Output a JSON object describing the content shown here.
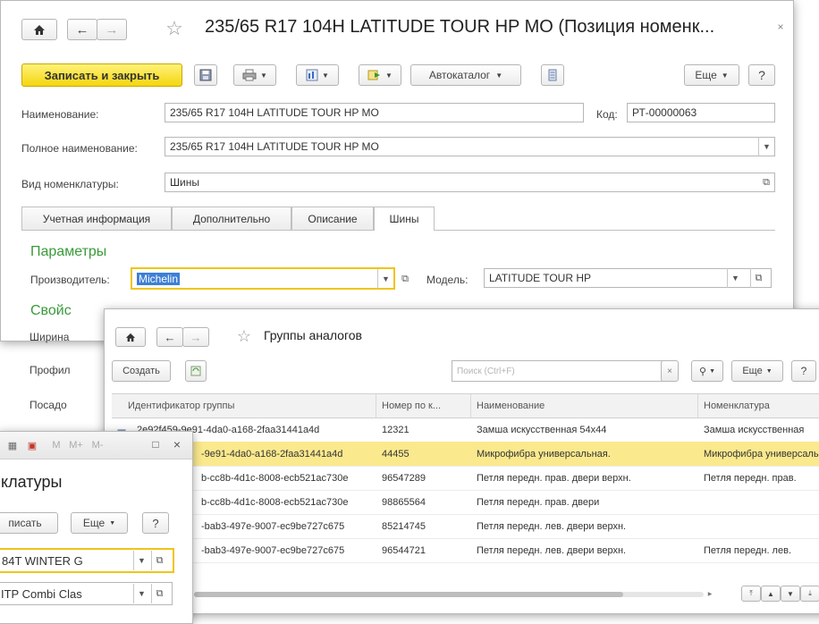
{
  "main": {
    "title": "235/65 R17 104H  LATITUDE TOUR HP MO (Позиция номенк...",
    "toolbar": {
      "save_close": "Записать и закрыть",
      "autocatalog": "Автокаталог",
      "more": "Еще",
      "help": "?"
    },
    "fields": {
      "name_label": "Наименование:",
      "name_value": "235/65 R17 104H  LATITUDE TOUR HP MO",
      "code_label": "Код:",
      "code_value": "РТ-00000063",
      "full_name_label": "Полное наименование:",
      "full_name_value": "235/65 R17 104H  LATITUDE TOUR HP MO",
      "kind_label": "Вид номенклатуры:",
      "kind_value": "Шины"
    },
    "tabs": [
      "Учетная информация",
      "Дополнительно",
      "Описание",
      "Шины"
    ],
    "params_title": "Параметры",
    "producer_label": "Производитель:",
    "producer_value": "Michelin",
    "model_label": "Модель:",
    "model_value": "LATITUDE TOUR HP",
    "props_title": "Свойс",
    "side_labels": [
      "Ширина",
      "Профил",
      "Посадо"
    ]
  },
  "analogs": {
    "title": "Группы аналогов",
    "create": "Создать",
    "search_placeholder": "Поиск (Ctrl+F)",
    "more": "Еще",
    "help": "?",
    "columns": [
      "Идентификатор группы",
      "Номер по к...",
      "Наименование",
      "Номенклатура"
    ],
    "rows": [
      {
        "id": "2e92f459-9e91-4da0-a168-2faa31441a4d",
        "num": "12321",
        "name": "Замша искусственная 54x44",
        "nom": "Замша искусственная"
      },
      {
        "id": "-9e91-4da0-a168-2faa31441a4d",
        "num": "44455",
        "name": "Микрофибра универсальная.",
        "nom": "Микрофибра универсальная"
      },
      {
        "id": "b-cc8b-4d1c-8008-ecb521ac730e",
        "num": "96547289",
        "name": "Петля передн. прав. двери верхн.",
        "nom": "Петля передн. прав."
      },
      {
        "id": "b-cc8b-4d1c-8008-ecb521ac730e",
        "num": "98865564",
        "name": "Петля передн. прав. двери",
        "nom": ""
      },
      {
        "id": "-bab3-497e-9007-ec9be727c675",
        "num": "85214745",
        "name": "Петля передн. лев. двери верхн.",
        "nom": ""
      },
      {
        "id": "-bab3-497e-9007-ec9be727c675",
        "num": "96544721",
        "name": "Петля передн. лев. двери верхн.",
        "nom": "Петля передн. лев."
      }
    ]
  },
  "small": {
    "title": "клатуры",
    "save": "писать",
    "more": "Еще",
    "help": "?",
    "field1": "84T WINTER G",
    "field2": "ITP Combi Clas",
    "toolbar_letters": [
      "M",
      "M+",
      "M-"
    ]
  },
  "colors": {
    "accent_yellow": "#f4d60f",
    "selected_row": "#fbe98e",
    "green_title": "#3a9a3a"
  }
}
